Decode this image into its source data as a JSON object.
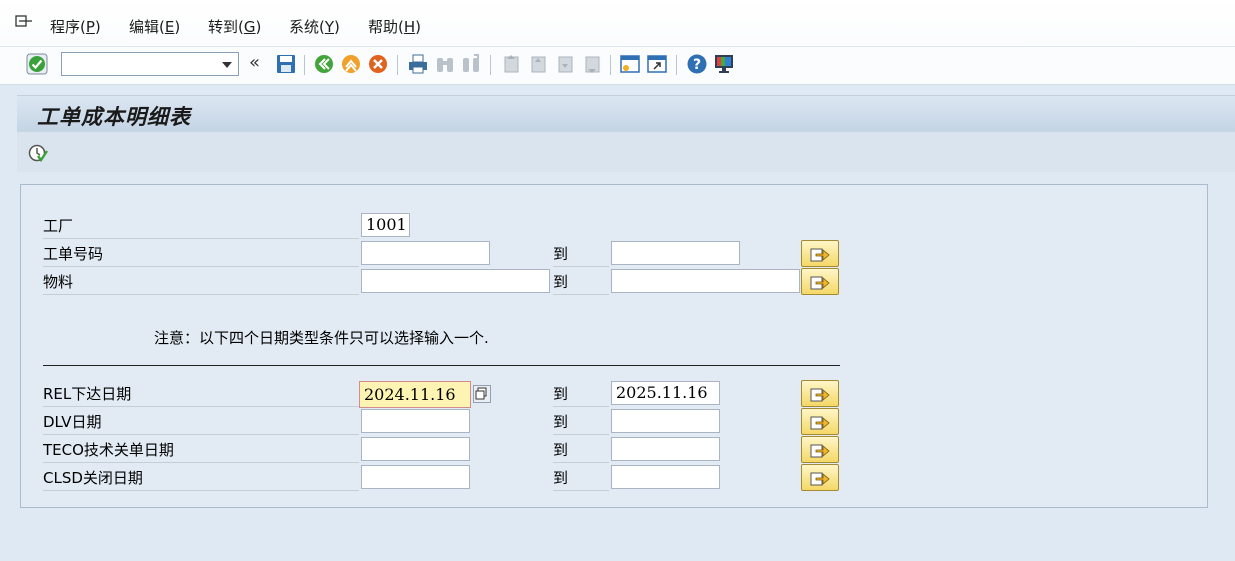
{
  "menu": {
    "items": [
      {
        "label": "程序",
        "key": "P"
      },
      {
        "label": "编辑",
        "key": "E"
      },
      {
        "label": "转到",
        "key": "G"
      },
      {
        "label": "系统",
        "key": "Y"
      },
      {
        "label": "帮助",
        "key": "H"
      }
    ]
  },
  "toolbar": {
    "command_value": ""
  },
  "title": "工单成本明细表",
  "form": {
    "rows": [
      {
        "label": "工厂",
        "low": "1001",
        "high": null
      },
      {
        "label": "工单号码",
        "low": "",
        "to": "到",
        "high": ""
      },
      {
        "label": "物料",
        "low": "",
        "to": "到",
        "high": ""
      }
    ],
    "note": "注意：以下四个日期类型条件只可以选择输入一个.",
    "date_rows": [
      {
        "label": "REL下达日期",
        "low": "2024.11.16",
        "to": "到",
        "high": "2025.11.16"
      },
      {
        "label": "DLV日期",
        "low": "",
        "to": "到",
        "high": ""
      },
      {
        "label": "TECO技术关单日期",
        "low": "",
        "to": "到",
        "high": ""
      },
      {
        "label": "CLSD关闭日期",
        "low": "",
        "to": "到",
        "high": ""
      }
    ]
  },
  "colors": {
    "background": "#dfe9f3",
    "title_bar": "#c4d4e5",
    "highlight_field": "#fdf3b3",
    "multi_button": "#f4d866"
  }
}
